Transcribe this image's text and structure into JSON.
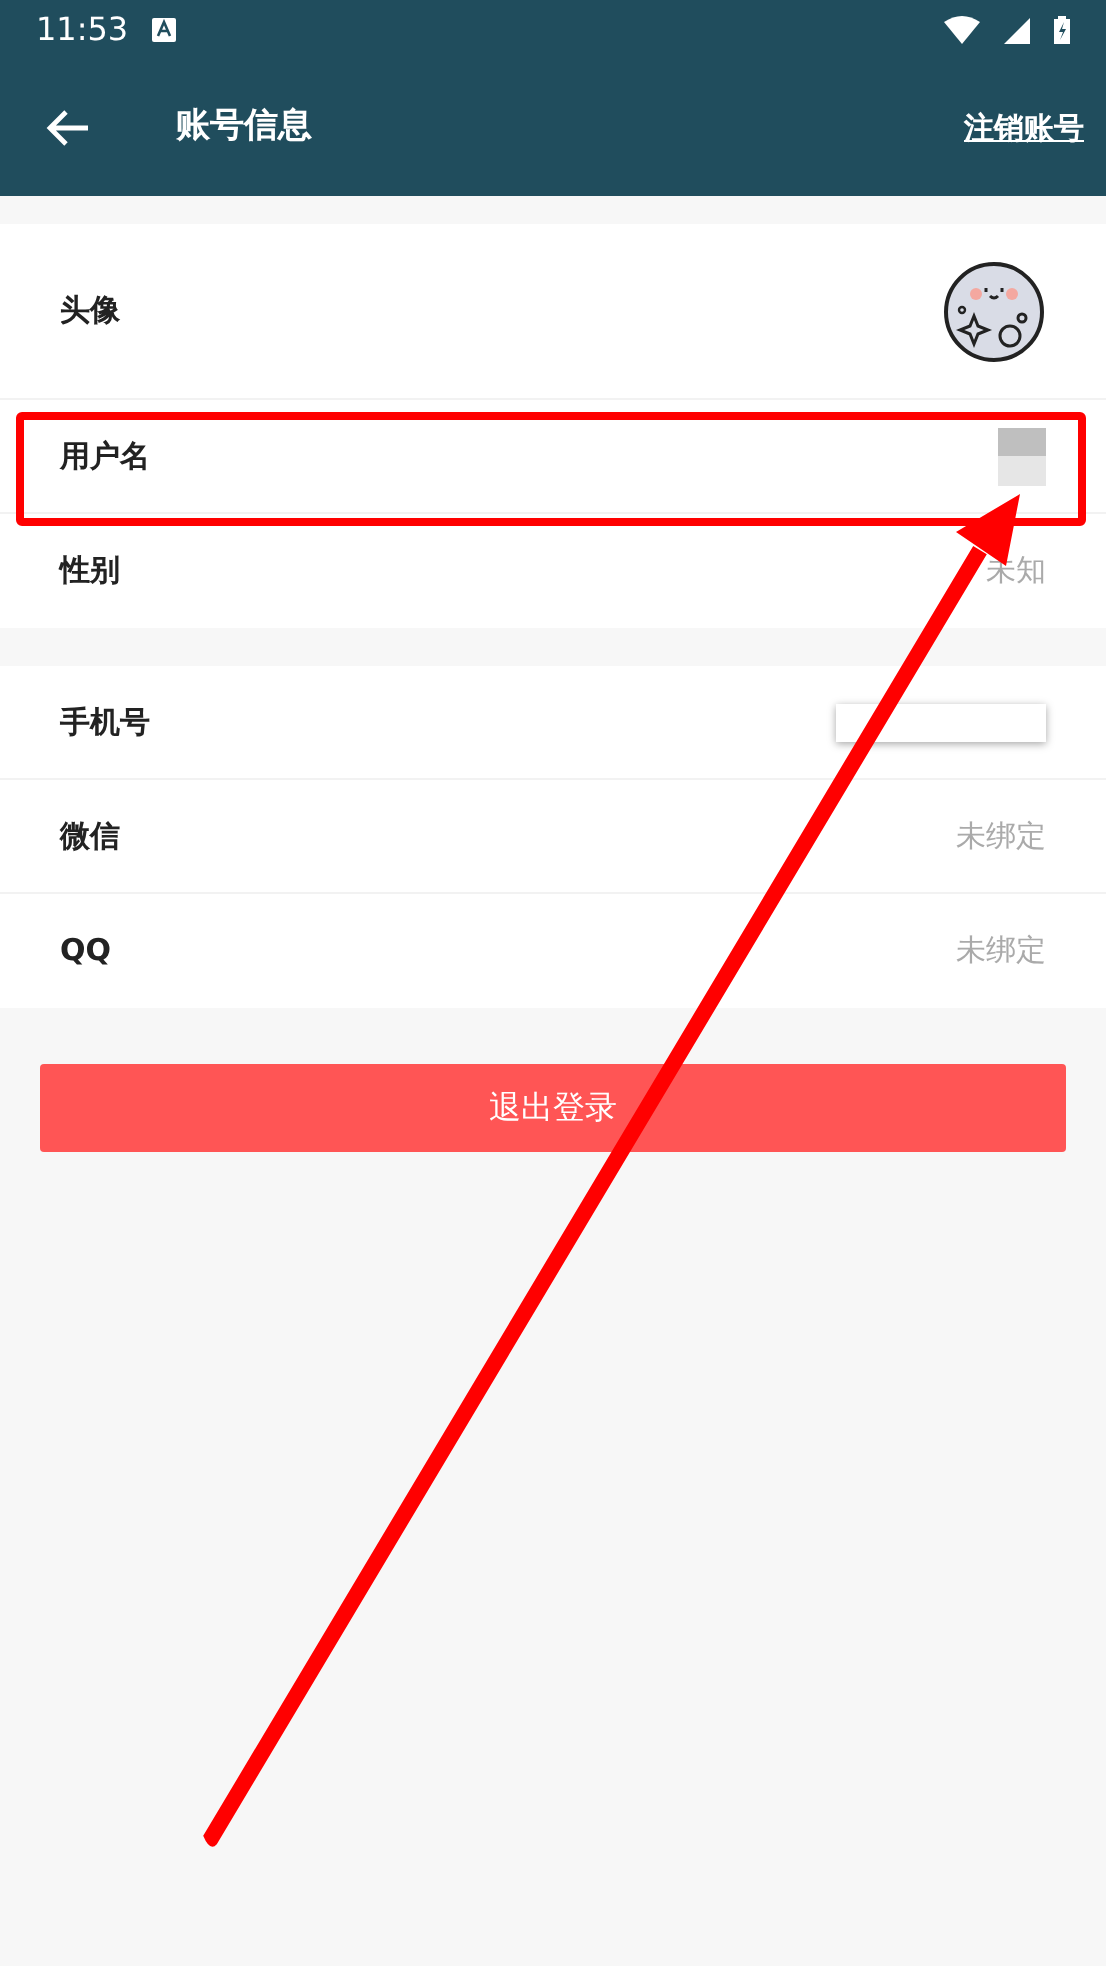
{
  "status_bar": {
    "time": "11:53"
  },
  "header": {
    "title": "账号信息",
    "action": "注销账号"
  },
  "sections": [
    {
      "rows": [
        {
          "label": "头像",
          "kind": "avatar"
        },
        {
          "label": "用户名",
          "kind": "redacted"
        },
        {
          "label": "性别",
          "kind": "text",
          "value": "未知"
        }
      ]
    },
    {
      "rows": [
        {
          "label": "手机号",
          "kind": "hidden_field"
        },
        {
          "label": "微信",
          "kind": "text",
          "value": "未绑定"
        },
        {
          "label": "QQ",
          "kind": "text",
          "value": "未绑定"
        }
      ]
    }
  ],
  "logout_button": "退出登录"
}
